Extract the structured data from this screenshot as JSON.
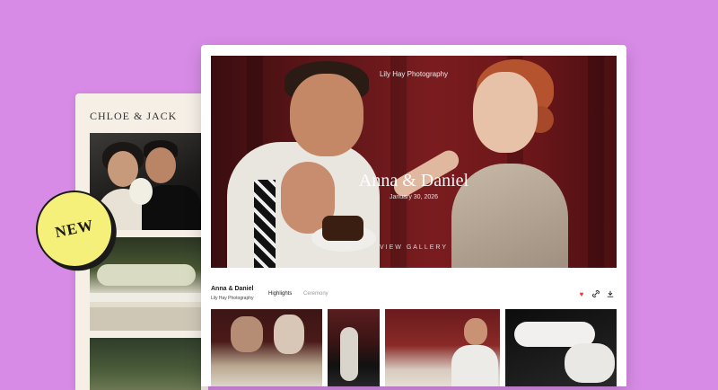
{
  "back_card": {
    "title": "CHLOE & JACK"
  },
  "badge": {
    "label": "NEW",
    "color": "#f4f07a"
  },
  "gallery": {
    "studio": "Lily Hay Photography",
    "title": "Anna & Daniel",
    "date": "January 30, 2026",
    "cta": "VIEW GALLERY",
    "info_bar": {
      "name": "Anna & Daniel",
      "studio": "Lily Hay Photography",
      "tabs": [
        {
          "label": "Highlights",
          "active": true
        },
        {
          "label": "Ceremony",
          "active": false
        }
      ],
      "actions": [
        "heart-icon",
        "link-icon",
        "download-icon"
      ]
    }
  },
  "colors": {
    "background": "#d88be6",
    "accent": "#e23b3b"
  }
}
